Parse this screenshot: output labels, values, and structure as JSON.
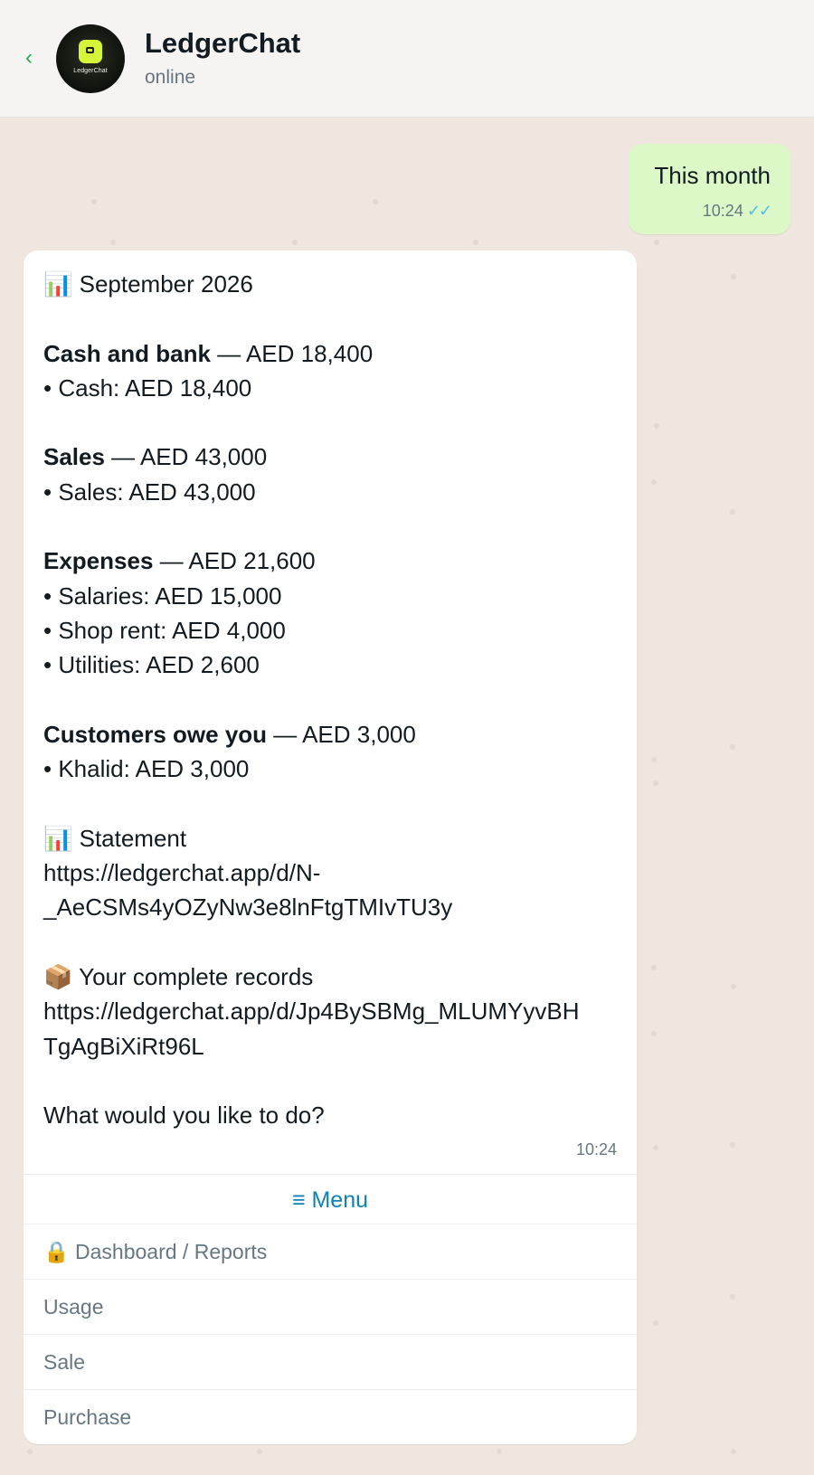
{
  "header": {
    "back_icon": "chevron-left-icon",
    "avatar_logo_text": "LedgerChat",
    "title": "LedgerChat",
    "status": "online"
  },
  "outgoing": {
    "text": "This month",
    "time": "10:24",
    "ticks": "✓✓"
  },
  "incoming": {
    "period": "📊 September 2026",
    "cash_heading": "Cash and bank",
    "cash_total": " — AED 18,400",
    "cash_items": [
      "• Cash: AED 18,400"
    ],
    "sales_heading": "Sales",
    "sales_total": " — AED 43,000",
    "sales_items": [
      "• Sales: AED 43,000"
    ],
    "expenses_heading": "Expenses",
    "expenses_total": " — AED 21,600",
    "expenses_items": [
      "• Salaries: AED 15,000",
      "• Shop rent: AED 4,000",
      "• Utilities: AED 2,600"
    ],
    "receivables_heading": "Customers owe you",
    "receivables_total": " — AED 3,000",
    "receivables_items": [
      "• Khalid: AED 3,000"
    ],
    "statement_label": "📊 Statement",
    "statement_url_lines": [
      "https://ledgerchat.app/d/N-",
      "_AeCSMs4yOZyNw3e8lnFtgTMIvTU3y"
    ],
    "records_label": "📦 Your complete records",
    "records_url_lines": [
      "https://ledgerchat.app/d/Jp4BySBMg_MLUMYyvBH",
      "TgAgBiXiRt96L"
    ],
    "prompt": "What would you like to do?",
    "time": "10:24"
  },
  "menu": {
    "button_label": "≡ Menu",
    "items": [
      "🔒 Dashboard / Reports",
      "Usage",
      "Sale",
      "Purchase"
    ]
  },
  "colors": {
    "chat_background": "#efe7df",
    "outgoing_bubble": "#dcf8c6",
    "read_ticks": "#53bdeb",
    "menu_link": "#0b84b5",
    "logo_accent": "#d6f53a"
  }
}
